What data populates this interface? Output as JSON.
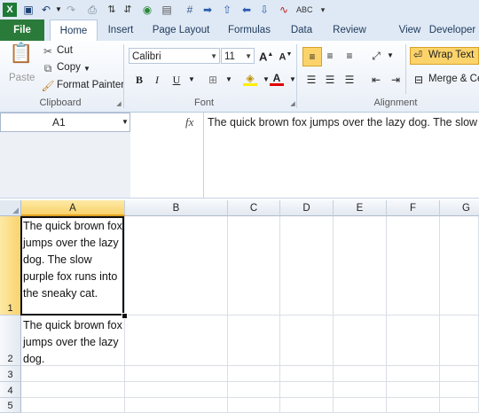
{
  "tabs": {
    "file": "File",
    "home": "Home",
    "insert": "Insert",
    "page_layout": "Page Layout",
    "formulas": "Formulas",
    "data": "Data",
    "review": "Review",
    "developer": "Developer"
  },
  "clipboard": {
    "paste": "Paste",
    "cut": "Cut",
    "copy": "Copy",
    "format_painter": "Format Painter",
    "label": "Clipboard"
  },
  "font": {
    "family": "Calibri",
    "size": "11",
    "bold": "B",
    "italic": "I",
    "underline": "U",
    "label": "Font"
  },
  "alignment": {
    "wrap_text": "Wrap Text",
    "merge": "Merge & Ce",
    "label": "Alignment"
  },
  "formula_bar": {
    "name_box": "A1",
    "fx": "fx",
    "content": "The quick brown fox jumps over the lazy dog. The slow"
  },
  "grid": {
    "columns": [
      "A",
      "B",
      "C",
      "D",
      "E",
      "F",
      "G"
    ],
    "rows": [
      "1",
      "2",
      "3",
      "4",
      "5"
    ],
    "cells": {
      "A1": "The quick brown fox jumps over the lazy dog. The slow purple fox runs into the sneaky cat.",
      "A2": "The quick brown fox jumps over the lazy dog."
    }
  },
  "colors": {
    "file_tab": "#2a7a3a",
    "selection": "#111111",
    "active_header": "#f9d36b"
  }
}
